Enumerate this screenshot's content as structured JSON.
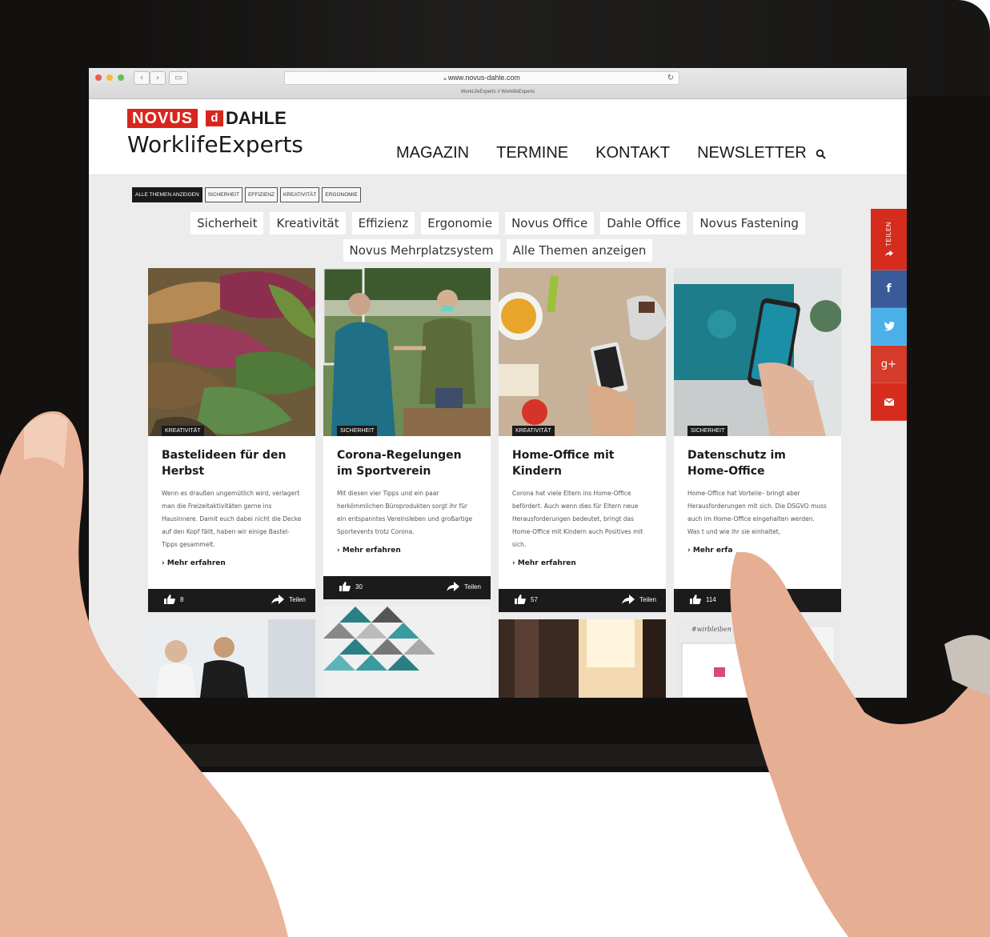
{
  "browser": {
    "url": "www.novus-dahle.com",
    "tab_title": "WorkLifeExperts // WorklifeExperts",
    "back": "‹",
    "forward": "›",
    "reload": "↻"
  },
  "header": {
    "logo_novus": "NOVUS",
    "logo_dahle": "DAHLE",
    "logo_dahle_mark": "d",
    "site_title": "WorklifeExperts",
    "nav": [
      "MAGAZIN",
      "TERMINE",
      "KONTAKT",
      "NEWSLETTER"
    ],
    "search_icon": "search-icon"
  },
  "tags": [
    "ALLE THEMEN ANZEIGEN",
    "SICHERHEIT",
    "EFFIZIENZ",
    "KREATIVITÄT",
    "ERGONOMIE"
  ],
  "categories_row1": [
    "Sicherheit",
    "Kreativität",
    "Effizienz",
    "Ergonomie",
    "Novus Office",
    "Dahle Office",
    "Novus Fastening"
  ],
  "categories_row2": [
    "Novus Mehrplatzsystem",
    "Alle Themen anzeigen"
  ],
  "cards": [
    {
      "badge": "KREATIVITÄT",
      "title": "Bastelideen für den Herbst",
      "text": "Wenn es draußen ungemütlich wird, verlagert man die Freizeitaktivitäten gerne ins Hausinnere. Damit euch dabei nicht die Decke auf den Kopf fällt, haben wir einige Bastel-Tipps gesammelt.",
      "more": "Mehr erfahren",
      "likes": "8",
      "share": "Teilen"
    },
    {
      "badge": "SICHERHEIT",
      "title": "Corona-Regelungen im Sportverein",
      "text": "Mit diesen vier Tipps und ein paar herkömmlichen Büroprodukten sorgt ihr für ein entspanntes Vereinsleben und großartige Sportevents trotz Corona.",
      "more": "Mehr erfahren",
      "likes": "30",
      "share": "Teilen"
    },
    {
      "badge": "KREATIVITÄT",
      "title": "Home-Office mit Kindern",
      "text": "Corona hat viele Eltern ins Home-Office befördert. Auch wenn dies für Eltern neue Herausforderungen bedeutet, bringt das Home-Office mit Kindern auch Positives mit sich.",
      "more": "Mehr erfahren",
      "likes": "57",
      "share": "Teilen"
    },
    {
      "badge": "SICHERHEIT",
      "title": "Datenschutz im Home-Office",
      "text": "Home-Office hat Vorteile– bringt aber Herausforderungen mit sich. Die DSGVO muss auch im Home-Office eingehalten werden. Was                 t und wie ihr sie einhaltet,",
      "more": "Mehr erfa",
      "likes": "114",
      "share": ""
    }
  ],
  "row2_caption": "#wirbleiben",
  "social": {
    "share_label": "TEILEN",
    "facebook": "f",
    "twitter": "twitter-icon",
    "googleplus": "g+",
    "mail": "mail-icon"
  },
  "colors": {
    "brand_red": "#d9261c",
    "dark": "#1b1b1b",
    "facebook": "#3a5a9a",
    "twitter": "#4bb0e8",
    "googleplus": "#d63a2b"
  }
}
